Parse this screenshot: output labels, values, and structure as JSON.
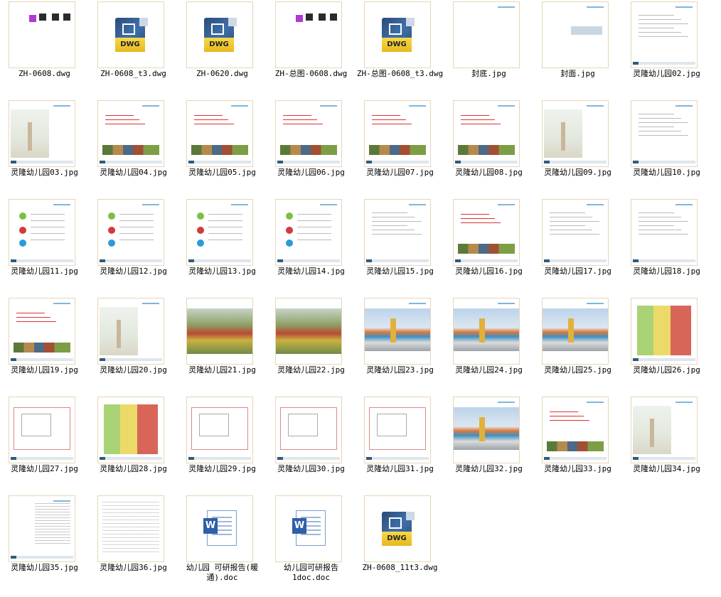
{
  "files": [
    {
      "name": "ZH-0608.dwg",
      "kind": "cad-small"
    },
    {
      "name": "ZH-0608_t3.dwg",
      "kind": "dwg"
    },
    {
      "name": "ZH-0620.dwg",
      "kind": "dwg"
    },
    {
      "name": "ZH-总图-0608.dwg",
      "kind": "cad-small"
    },
    {
      "name": "ZH-总图-0608_t3.dwg",
      "kind": "dwg"
    },
    {
      "name": "封底.jpg",
      "kind": "blank"
    },
    {
      "name": "封面.jpg",
      "kind": "cover"
    },
    {
      "name": "灵隆幼儿园02.jpg",
      "kind": "text-page"
    },
    {
      "name": "灵隆幼儿园03.jpg",
      "kind": "faded"
    },
    {
      "name": "灵隆幼儿园04.jpg",
      "kind": "photos"
    },
    {
      "name": "灵隆幼儿园05.jpg",
      "kind": "photos"
    },
    {
      "name": "灵隆幼儿园06.jpg",
      "kind": "photos"
    },
    {
      "name": "灵隆幼儿园07.jpg",
      "kind": "photos"
    },
    {
      "name": "灵隆幼儿园08.jpg",
      "kind": "photos"
    },
    {
      "name": "灵隆幼儿园09.jpg",
      "kind": "faded"
    },
    {
      "name": "灵隆幼儿园10.jpg",
      "kind": "text-page"
    },
    {
      "name": "灵隆幼儿园11.jpg",
      "kind": "circles"
    },
    {
      "name": "灵隆幼儿园12.jpg",
      "kind": "circles"
    },
    {
      "name": "灵隆幼儿园13.jpg",
      "kind": "circles"
    },
    {
      "name": "灵隆幼儿园14.jpg",
      "kind": "circles"
    },
    {
      "name": "灵隆幼儿园15.jpg",
      "kind": "text-page"
    },
    {
      "name": "灵隆幼儿园16.jpg",
      "kind": "photos"
    },
    {
      "name": "灵隆幼儿园17.jpg",
      "kind": "text-page"
    },
    {
      "name": "灵隆幼儿园18.jpg",
      "kind": "text-page"
    },
    {
      "name": "灵隆幼儿园19.jpg",
      "kind": "photos"
    },
    {
      "name": "灵隆幼儿园20.jpg",
      "kind": "faded"
    },
    {
      "name": "灵隆幼儿园21.jpg",
      "kind": "render"
    },
    {
      "name": "灵隆幼儿园22.jpg",
      "kind": "render"
    },
    {
      "name": "灵隆幼儿园23.jpg",
      "kind": "street"
    },
    {
      "name": "灵隆幼儿园24.jpg",
      "kind": "street"
    },
    {
      "name": "灵隆幼儿园25.jpg",
      "kind": "street"
    },
    {
      "name": "灵隆幼儿园26.jpg",
      "kind": "colorplan"
    },
    {
      "name": "灵隆幼儿园27.jpg",
      "kind": "plan"
    },
    {
      "name": "灵隆幼儿园28.jpg",
      "kind": "colorplan"
    },
    {
      "name": "灵隆幼儿园29.jpg",
      "kind": "plan"
    },
    {
      "name": "灵隆幼儿园30.jpg",
      "kind": "plan"
    },
    {
      "name": "灵隆幼儿园31.jpg",
      "kind": "plan"
    },
    {
      "name": "灵隆幼儿园32.jpg",
      "kind": "street"
    },
    {
      "name": "灵隆幼儿园33.jpg",
      "kind": "photos"
    },
    {
      "name": "灵隆幼儿园34.jpg",
      "kind": "faded"
    },
    {
      "name": "灵隆幼儿园35.jpg",
      "kind": "table"
    },
    {
      "name": "灵隆幼儿园36.jpg",
      "kind": "sheet"
    },
    {
      "name": "幼儿园 可研报告(暖通).doc",
      "kind": "doc"
    },
    {
      "name": "幼儿园可研报告1doc.doc",
      "kind": "doc"
    },
    {
      "name": "ZH-0608_11t3.dwg",
      "kind": "dwg"
    }
  ],
  "labels": [
    "ZH-0608.dwg",
    "ZH-0608_t3.dwg",
    "ZH-0620.dwg",
    "ZH-总图-0608.dwg",
    "ZH-总图-0608_t3.dwg",
    "封底.jpg",
    "封面.jpg",
    "灵隆幼儿园02.jpg",
    "灵隆幼儿园03.jpg",
    "灵隆幼儿园04.jpg",
    "灵隆幼儿园05.jpg",
    "灵隆幼儿园06.jpg",
    "灵隆幼儿园07.jpg",
    "灵隆幼儿园08.jpg",
    "灵隆幼儿园09.jpg",
    "灵隆幼儿园10.jpg",
    "灵隆幼儿园11.jpg",
    "灵隆幼儿园12.jpg",
    "灵隆幼儿园13.jpg",
    "灵隆幼儿园14.jpg",
    "灵隆幼儿园15.jpg",
    "灵隆幼儿园16.jpg",
    "灵隆幼儿园17.jpg",
    "灵隆幼儿园18.jpg",
    "灵隆幼儿园19.jpg",
    "灵隆幼儿园20.jpg",
    "灵隆幼儿园21.jpg",
    "灵隆幼儿园22.jpg",
    "灵隆幼儿园23.jpg",
    "灵隆幼儿园24.jpg",
    "灵隆幼儿园25.jpg",
    "灵隆幼儿园26.jpg",
    "灵隆幼儿园27.jpg",
    "灵隆幼儿园28.jpg",
    "灵隆幼儿园29.jpg",
    "灵隆幼儿园30.jpg",
    "灵隆幼儿园31.jpg",
    "灵隆幼儿园32.jpg",
    "灵隆幼儿园33.jpg",
    "灵隆幼儿园34.jpg",
    "灵隆幼儿园35.jpg",
    "灵隆幼儿园36.jpg",
    "幼儿园 可研报告(暖通).doc",
    "幼儿园可研报告1doc.doc",
    "ZH-0608_11t3.dwg"
  ],
  "icon_text": {
    "dwg": "DWG",
    "word": "W"
  },
  "colors": {
    "thumb_border": "#e6d6b8",
    "dwg_blue": "#2a4b78",
    "dwg_yellow": "#f7d84a",
    "word_blue": "#2e5fa8",
    "accent_red": "#dd3333"
  }
}
